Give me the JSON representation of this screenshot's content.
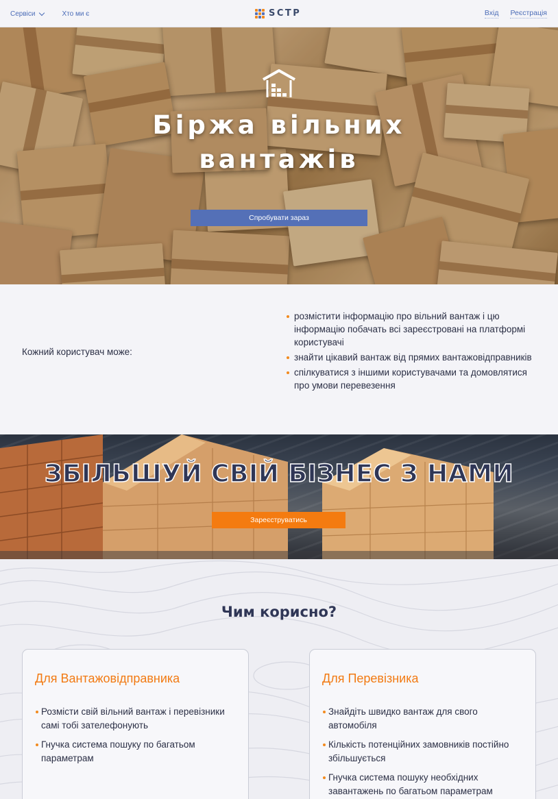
{
  "header": {
    "nav_services": "Сервіси",
    "nav_about": "Хто ми є",
    "logo_text": "SCTP",
    "login": "Вхід",
    "register": "Реєстрація"
  },
  "hero": {
    "title_line1": "Біржа вільних",
    "title_line2": "вантажів",
    "cta": "Спробувати зараз",
    "icon": "warehouse-icon"
  },
  "info": {
    "lead": "Кожний користувач може:",
    "items": [
      "розмістити інформацію про вільний вантаж і цю інформацію побачать всі зареєстровані на платформі користувачі",
      "знайти цікавий вантаж від прямих вантажовідправників",
      "спілкуватися з іншими користувачами та домовлятися про умови перевезення"
    ]
  },
  "banner": {
    "title": "ЗБІЛЬШУЙ СВІЙ БІЗНЕС З НАМИ",
    "cta": "Зареєструватись"
  },
  "benefits": {
    "title": "Чим корисно?",
    "cards": [
      {
        "title": "Для Вантажовідправника",
        "items": [
          "Розмісти свій вільний вантаж і перевізники самі тобі зателефонують",
          "Гнучка система пошуку по багатьом параметрам"
        ]
      },
      {
        "title": "Для Перевізника",
        "items": [
          "Знайдіть швидко вантаж для свого автомобіля",
          "Кількість потенційних замовників постійно збільшується",
          "Гнучка система пошуку необхідних завантажень по багатьом параметрам"
        ]
      }
    ]
  },
  "colors": {
    "accent_blue": "#5470b7",
    "accent_orange": "#f47b10",
    "heading_dark": "#2f3656"
  }
}
